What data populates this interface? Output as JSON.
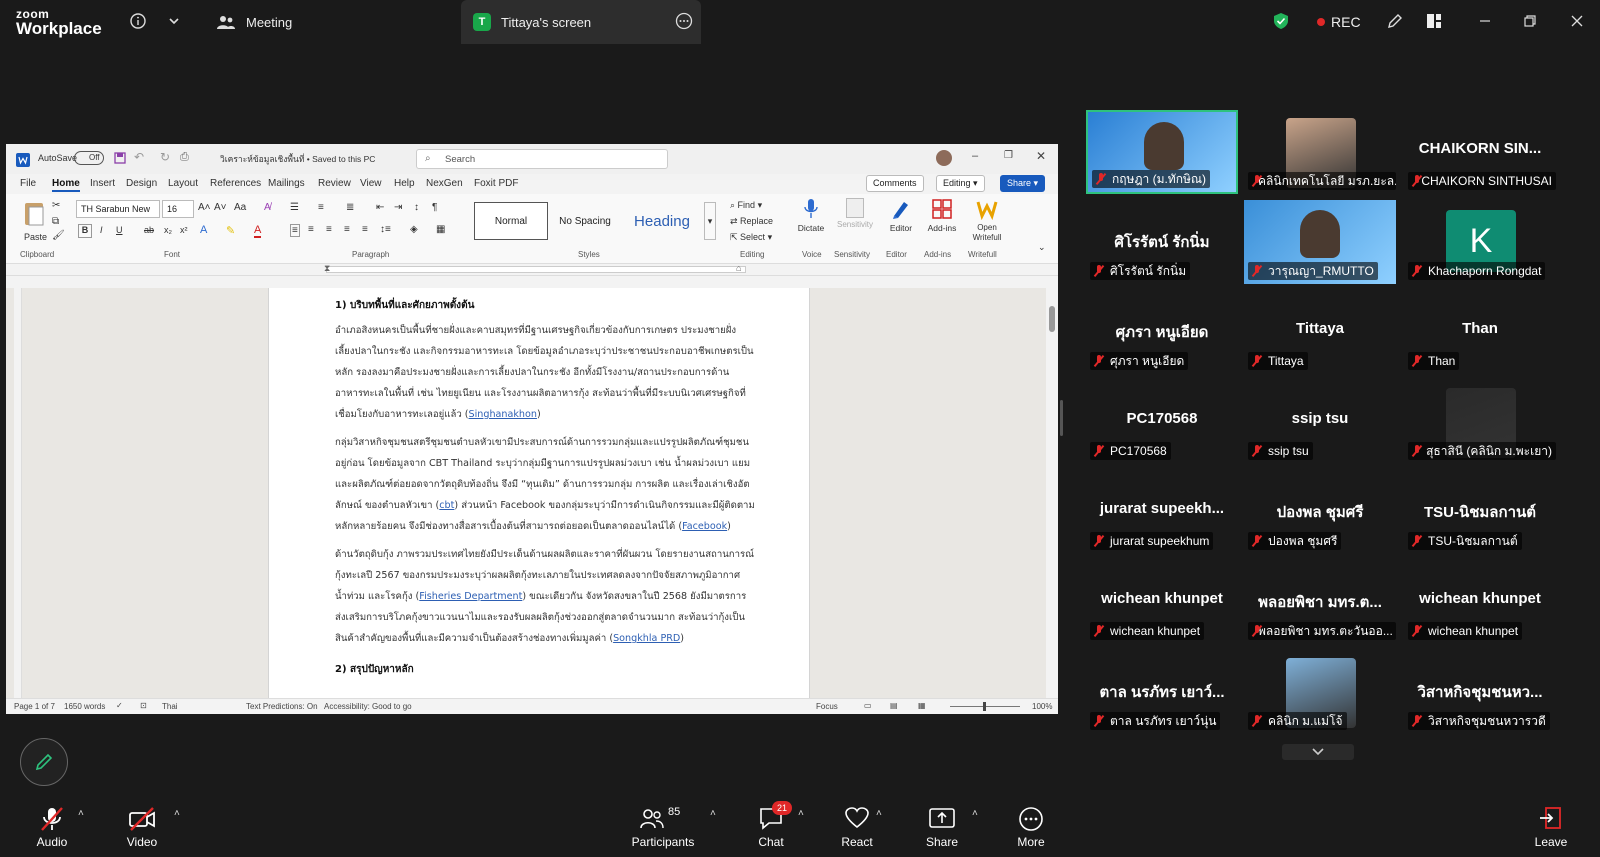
{
  "zoom": {
    "logo_top": "zoom",
    "logo_bottom": "Workplace",
    "tabs": {
      "meeting": "Meeting",
      "screen": "Tittaya's screen",
      "screen_badge": "T"
    },
    "rec": "REC"
  },
  "word": {
    "autosave": "AutoSave",
    "autosave_state": "Off",
    "doc_title": "วิเคราะห์ข้อมูลเชิงพื้นที่ • Saved to this PC",
    "search_placeholder": "Search",
    "menu": [
      "File",
      "Home",
      "Insert",
      "Design",
      "Layout",
      "References",
      "Mailings",
      "Review",
      "View",
      "Help",
      "NexGen",
      "Foxit PDF"
    ],
    "comments": "Comments",
    "editing": "Editing",
    "share": "Share",
    "font_name": "TH Sarabun New",
    "font_size": "16",
    "paste": "Paste",
    "groups": {
      "clipboard": "Clipboard",
      "font": "Font",
      "paragraph": "Paragraph",
      "styles": "Styles",
      "editing": "Editing",
      "voice": "Voice",
      "sensitivity": "Sensitivity",
      "editor": "Editor",
      "addins": "Add-ins",
      "writefull": "Writefull"
    },
    "styles": {
      "normal": "Normal",
      "nospacing": "No Spacing",
      "heading": "Heading"
    },
    "find": "Find",
    "replace": "Replace",
    "select": "Select",
    "dictate": "Dictate",
    "sensitivity_btn": "Sensitivity",
    "editor_btn": "Editor",
    "addins_btn": "Add-ins",
    "writefull_btn": "Open Writefull",
    "doc": {
      "h1": "1) บริบทพื้นที่และศักยภาพตั้งต้น",
      "p1": "อำเภอสิงหนครเป็นพื้นที่ชายฝั่งและคาบสมุทรที่มีฐานเศรษฐกิจเกี่ยวข้องกับการเกษตร ประมงชายฝั่ง เลี้ยงปลาในกระชัง และกิจกรรมอาหารทะเล โดยข้อมูลอำเภอระบุว่าประชาชนประกอบอาชีพเกษตรเป็นหลัก รองลงมาคือประมงชายฝั่งและการเลี้ยงปลาในกระชัง อีกทั้งมีโรงงาน/สถานประกอบการด้านอาหารทะเลในพื้นที่ เช่น ไทยยูเนียน และโรงงานผลิตอาหารกุ้ง สะท้อนว่าพื้นที่มีระบบนิเวศเศรษฐกิจที่เชื่อมโยงกับอาหารทะเลอยู่แล้ว (",
      "p1_link": "Singhanakhon",
      "p1_end": ")",
      "p2": "กลุ่มวิสาหกิจชุมชนสตรีชุมชนตำบลหัวเขามีประสบการณ์ด้านการรวมกลุ่มและแปรรูปผลิตภัณฑ์ชุมชนอยู่ก่อน โดยข้อมูลจาก CBT Thailand ระบุว่ากลุ่มมีฐานการแปรรูปผลม่วงเบา เช่น น้ำผลม่วงเบา แยม และผลิตภัณฑ์ต่อยอดจากวัตถุดิบท้องถิ่น จึงมี “ทุนเดิม” ด้านการรวมกลุ่ม การผลิต และเรื่องเล่าเชิงอัตลักษณ์ ของตำบลหัวเขา (",
      "p2_link1": "cbt",
      "p2_mid": ") ส่วนหน้า Facebook ของกลุ่มระบุว่ามีการดำเนินกิจกรรมและมีผู้ติดตามหลักหลายร้อยคน จึงมีช่องทางสื่อสารเบื้องต้นที่สามารถต่อยอดเป็นตลาดออนไลน์ได้ (",
      "p2_link2": "Facebook",
      "p2_end": ")",
      "p3": "ด้านวัตถุดิบกุ้ง ภาพรวมประเทศไทยยังมีประเด็นด้านผลผลิตและราคาที่ผันผวน โดยรายงานสถานการณ์กุ้งทะเลปี 2567 ของกรมประมงระบุว่าผลผลิตกุ้งทะเลภายในประเทศลดลงจากปัจจัยสภาพภูมิอากาศ น้ำท่วม และโรคกุ้ง (",
      "p3_link1": "Fisheries Department",
      "p3_mid": ") ขณะเดียวกัน จังหวัดสงขลาในปี 2568 ยังมีมาตรการส่งเสริมการบริโภคกุ้งขาวแวนนาไมและรองรับผลผลิตกุ้งช่วงออกสู่ตลาดจำนวนมาก สะท้อนว่ากุ้งเป็นสินค้าสำคัญของพื้นที่และมีความจำเป็นต้องสร้างช่องทางเพิ่มมูลค่า (",
      "p3_link2": "Songkhla PRD",
      "p3_end": ")",
      "h2": "2) สรุปปัญหาหลัก"
    },
    "status": {
      "page": "Page 1 of 7",
      "words": "1650 words",
      "lang": "Thai",
      "predictions": "Text Predictions: On",
      "accessibility": "Accessibility: Good to go",
      "focus": "Focus",
      "zoom": "100%"
    }
  },
  "participants": [
    {
      "name": "กฤษฎา (ม.ทักษิณ)",
      "kind": "video",
      "color": "#2a7fd4"
    },
    {
      "name": "คลินิกเทคโนโลยี มรภ.ยะล...",
      "kind": "photo",
      "color": "#c9a48a"
    },
    {
      "name": "CHAIKORN SINTHUSAI",
      "big": "CHAIKORN SIN...",
      "kind": "name"
    },
    {
      "name": "ศิโรรัตน์ รักนิ่ม",
      "big": "ศิโรรัตน์ รักนิ่ม",
      "kind": "name"
    },
    {
      "name": "วารุณญา_RMUTTO",
      "kind": "video",
      "color": "#3a8fd8"
    },
    {
      "name": "Khachaporn Rongdat",
      "big": "K",
      "kind": "avatar",
      "color": "#0f8c72"
    },
    {
      "name": "ศุภรา หนูเอียด",
      "big": "ศุภรา หนูเอียด",
      "kind": "name"
    },
    {
      "name": "Tittaya",
      "big": "Tittaya",
      "kind": "name"
    },
    {
      "name": "Than",
      "big": "Than",
      "kind": "name"
    },
    {
      "name": "PC170568",
      "big": "PC170568",
      "kind": "name"
    },
    {
      "name": "ssip tsu",
      "big": "ssip tsu",
      "kind": "name"
    },
    {
      "name": "สุธาสินี (คลินิก ม.พะเยา)",
      "kind": "photo",
      "color": "#2a2a2a"
    },
    {
      "name": "jurarat supeekhum",
      "big": "jurarat supeekh...",
      "kind": "name"
    },
    {
      "name": "ปองพล ชุมศรี",
      "big": "ปองพล ชุมศรี",
      "kind": "name"
    },
    {
      "name": "TSU-นิชมลกานต์",
      "big": "TSU-นิชมลกานต์",
      "kind": "name"
    },
    {
      "name": "wichean khunpet",
      "big": "wichean khunpet",
      "kind": "name"
    },
    {
      "name": "พลอยพิชา มทร.ตะวันออ...",
      "big": "พลอยพิชา มทร.ต...",
      "kind": "name"
    },
    {
      "name": "wichean khunpet",
      "big": "wichean khunpet",
      "kind": "name"
    },
    {
      "name": "ตาล นรภัทร เยาว์นุ่น",
      "big": "ตาล นรภัทร เยาว์...",
      "kind": "name"
    },
    {
      "name": "คลินิก ม.แม่โจ้",
      "kind": "photo",
      "color": "#7fb0d8"
    },
    {
      "name": "วิสาหกิจชุมชนหวารวดี",
      "big": "วิสาหกิจชุมชนหว...",
      "kind": "name"
    }
  ],
  "bottombar": {
    "audio": "Audio",
    "video": "Video",
    "participants": "Participants",
    "participants_count": "85",
    "chat": "Chat",
    "chat_badge": "21",
    "react": "React",
    "share": "Share",
    "more": "More",
    "leave": "Leave"
  }
}
